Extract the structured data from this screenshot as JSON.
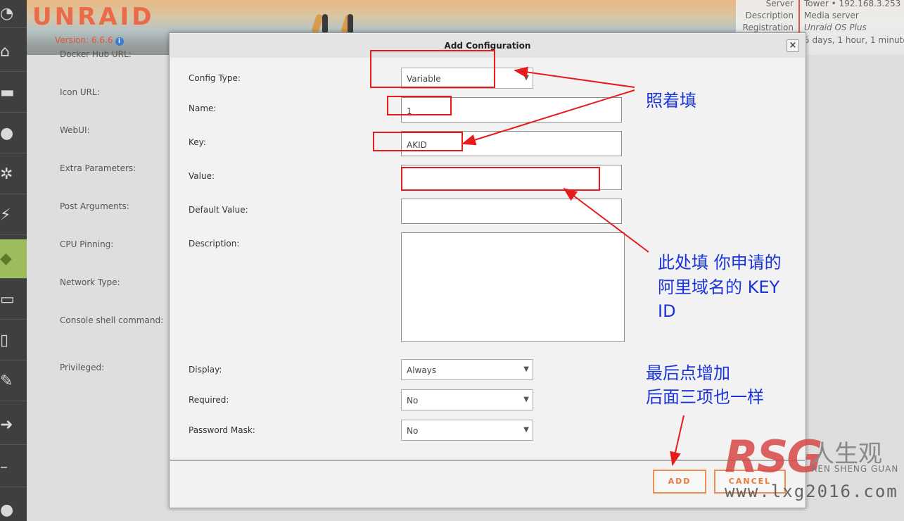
{
  "header": {
    "logo": "UNRAID",
    "version": "Version: 6.6.6",
    "server_info": [
      {
        "label": "Server",
        "value": "Tower • 192.168.3.253"
      },
      {
        "label": "Description",
        "value": "Media server"
      },
      {
        "label": "Registration",
        "value": "Unraid OS Plus"
      },
      {
        "label": "",
        "value": "5 days, 1 hour, 1 minute"
      }
    ]
  },
  "sidebar": {
    "icons": [
      "dashboard-icon",
      "home-icon",
      "folder-icon",
      "users-icon",
      "settings-icon",
      "plugin-icon",
      "docker-icon",
      "vm-icon",
      "device-icon",
      "tools-icon",
      "logout-icon",
      "minus-icon",
      "chat-icon"
    ],
    "active_index": 6
  },
  "background_form": {
    "labels": [
      "Docker Hub URL:",
      "Icon URL:",
      "WebUI:",
      "Extra Parameters:",
      "Post Arguments:",
      "CPU Pinning:",
      "Network Type:",
      "Console shell command:",
      "Privileged:"
    ]
  },
  "modal": {
    "title": "Add Configuration",
    "close_label": "×",
    "fields": {
      "config_type": {
        "label": "Config Type:",
        "value": "Variable"
      },
      "name": {
        "label": "Name:",
        "value": "1"
      },
      "key": {
        "label": "Key:",
        "value": "AKID"
      },
      "value": {
        "label": "Value:",
        "value": ""
      },
      "default_value": {
        "label": "Default Value:",
        "value": ""
      },
      "description": {
        "label": "Description:",
        "value": ""
      },
      "display": {
        "label": "Display:",
        "value": "Always"
      },
      "required": {
        "label": "Required:",
        "value": "No"
      },
      "password_mask": {
        "label": "Password Mask:",
        "value": "No"
      }
    },
    "add_label": "ADD",
    "cancel_label": "CANCEL"
  },
  "annotations": {
    "fill_as_shown": "照着填",
    "value_hint_line1": "此处填 你申请的",
    "value_hint_line2": "阿里域名的 KEY",
    "value_hint_line3": "ID",
    "final_hint_line1": "最后点增加",
    "final_hint_line2": "后面三项也一样",
    "colors": {
      "annotation_text": "#1b33d8",
      "annotation_box": "#e81b1b"
    }
  },
  "watermark": {
    "brand": "RSG",
    "cn": "人生观",
    "pinyin": "REN SHENG GUAN",
    "url": "www.lxg2016.com"
  }
}
